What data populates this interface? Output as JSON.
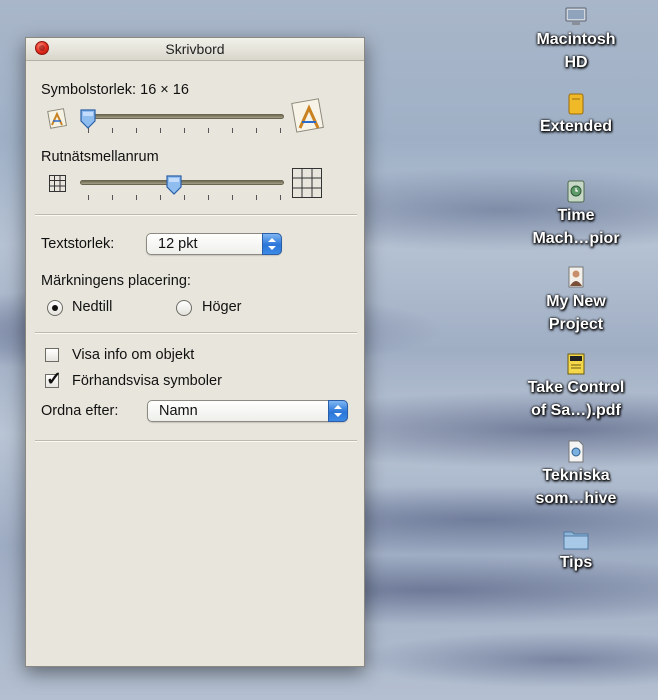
{
  "window": {
    "title": "Skrivbord"
  },
  "icon_size": {
    "label": "Symbolstorlek:",
    "value": "16 × 16",
    "slider_fraction": 0.0
  },
  "grid_spacing": {
    "label": "Rutnätsmellanrum",
    "slider_fraction": 0.47
  },
  "text_size": {
    "label": "Textstorlek:",
    "selected": "12 pkt"
  },
  "label_position": {
    "label": "Märkningens placering:",
    "options": [
      "Nedtill",
      "Höger"
    ],
    "selected": "Nedtill"
  },
  "checkboxes": [
    {
      "label": "Visa info om objekt",
      "checked": false
    },
    {
      "label": "Förhandsvisa symboler",
      "checked": true
    }
  ],
  "arrange_by": {
    "label": "Ordna efter:",
    "selected": "Namn"
  },
  "desktop_icons": [
    {
      "name_line1": "Macintosh",
      "name_line2": "HD",
      "icon": "hard-drive-icon"
    },
    {
      "name_line1": "Extended",
      "name_line2": "",
      "icon": "external-drive-icon"
    },
    {
      "name_line1": "Time",
      "name_line2": "Mach…pior",
      "icon": "time-machine-drive-icon"
    },
    {
      "name_line1": "My New",
      "name_line2": "Project",
      "icon": "project-file-icon"
    },
    {
      "name_line1": "Take Control",
      "name_line2": "of Sa…).pdf",
      "icon": "pdf-file-icon"
    },
    {
      "name_line1": "Tekniska",
      "name_line2": "som…hive",
      "icon": "archive-file-icon"
    },
    {
      "name_line1": "Tips",
      "name_line2": "",
      "icon": "folder-icon"
    }
  ],
  "colors": {
    "accent": "#2a76d8",
    "panel_bg": "#e8e6dc",
    "close": "#e0281a"
  }
}
